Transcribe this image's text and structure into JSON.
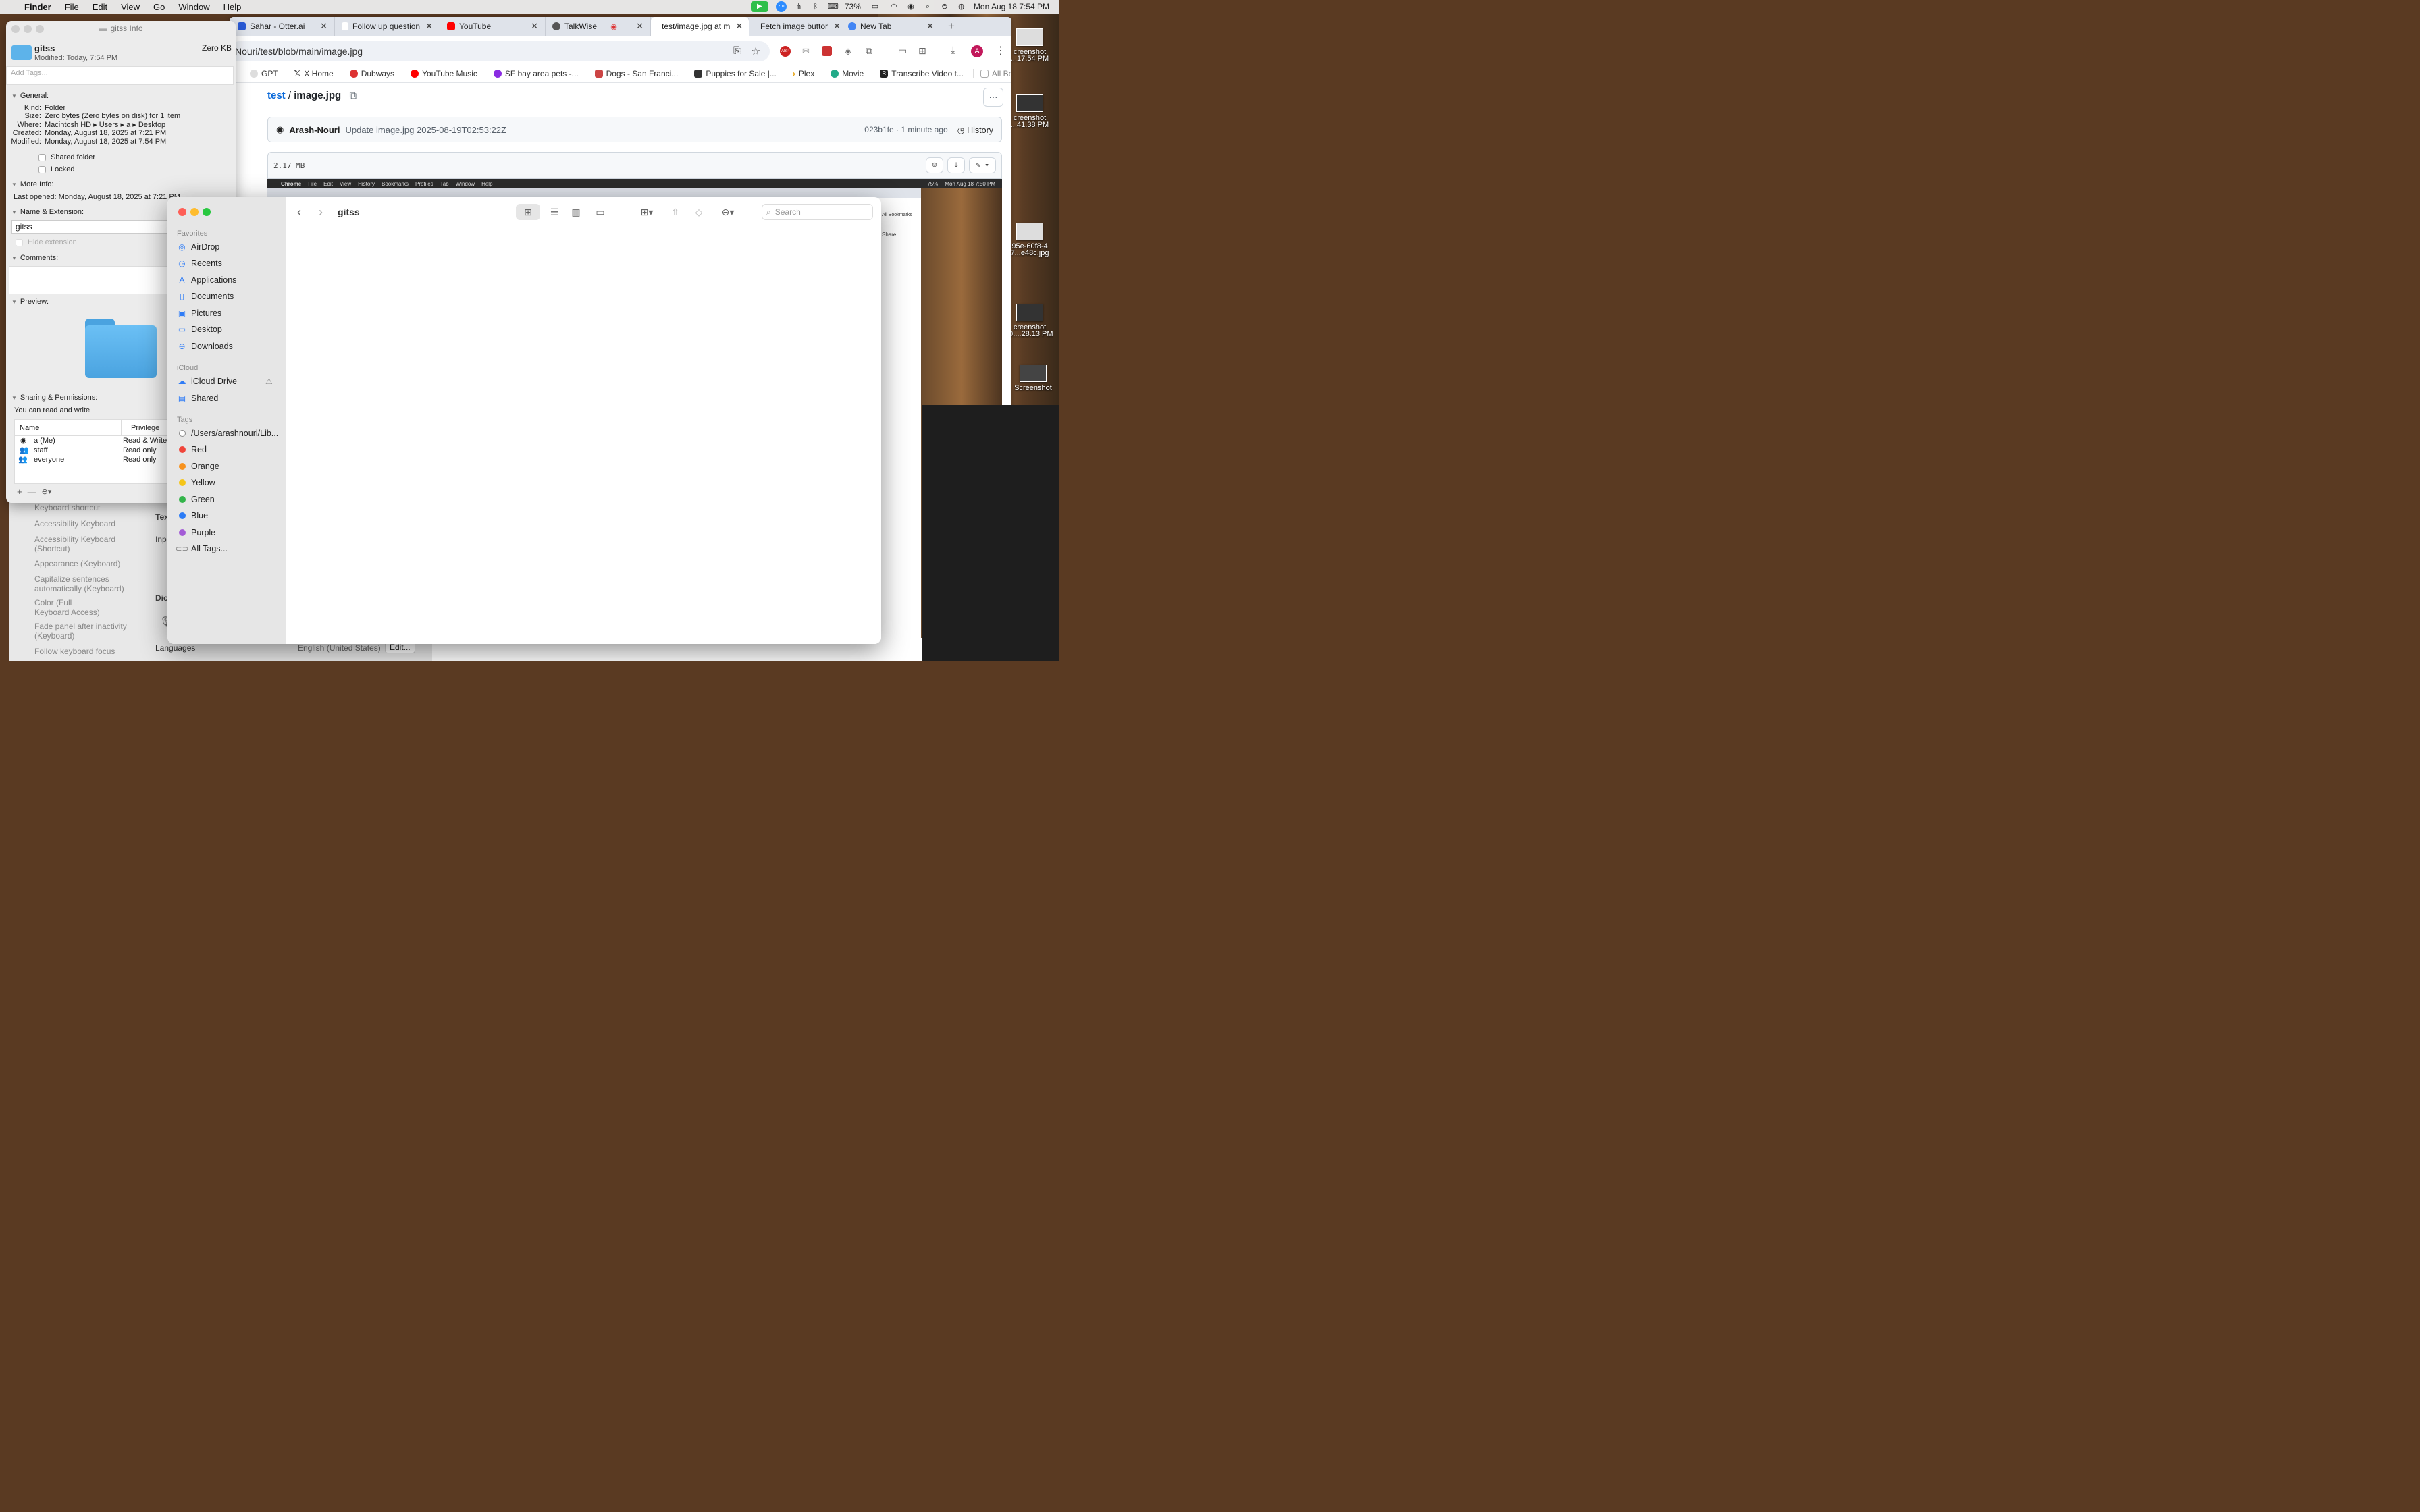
{
  "menubar": {
    "app": "Finder",
    "items": [
      "File",
      "Edit",
      "View",
      "Go",
      "Window",
      "Help"
    ],
    "battery": "73%",
    "datetime": "Mon Aug 18  7:54 PM"
  },
  "chrome": {
    "tabs": [
      {
        "label": "Sahar - Otter.ai"
      },
      {
        "label": "Follow up question"
      },
      {
        "label": "YouTube"
      },
      {
        "label": "TalkWise"
      },
      {
        "label": "test/image.jpg at m"
      },
      {
        "label": "Fetch image buttor"
      },
      {
        "label": "New Tab"
      }
    ],
    "url": "Nouri/test/blob/main/image.jpg",
    "bookmarks": [
      "GPT",
      "X Home",
      "Dubways",
      "YouTube Music",
      "SF bay area pets -...",
      "Dogs - San Franci...",
      "Puppies for Sale |...",
      "Plex",
      "Movie",
      "Transcribe Video t...",
      "All Bookmarks"
    ]
  },
  "github": {
    "repo": "test",
    "sep": "/",
    "file": "image.jpg",
    "author": "Arash-Nouri",
    "commit_msg": "Update image.jpg 2025-08-19T02:53:22Z",
    "commit_meta": "023b1fe · 1 minute ago",
    "history": "History",
    "size": "2.17 MB"
  },
  "embedded": {
    "menubar": [
      "Chrome",
      "File",
      "Edit",
      "View",
      "History",
      "Bookmarks",
      "Profiles",
      "Tab",
      "Window",
      "Help"
    ],
    "datetime": "Mon Aug 18  7:50 PM",
    "battery": "75%",
    "share": "Share",
    "all_bookmarks": "All Bookmarks"
  },
  "info": {
    "title": "gitss Info",
    "name": "gitss",
    "size_head": "Zero KB",
    "modified_head": "Modified: Today, 7:54 PM",
    "tags_placeholder": "Add Tags...",
    "general_head": "General:",
    "kind_k": "Kind:",
    "kind_v": "Folder",
    "size_k": "Size:",
    "size_v": "Zero bytes (Zero bytes on disk) for 1 item",
    "where_k": "Where:",
    "where_v": "Macintosh HD ▸ Users ▸ a ▸ Desktop",
    "created_k": "Created:",
    "created_v": "Monday, August 18, 2025 at 7:21 PM",
    "modified_k": "Modified:",
    "modified_v": "Monday, August 18, 2025 at 7:54 PM",
    "shared_folder": "Shared folder",
    "locked": "Locked",
    "more_info": "More Info:",
    "last_opened": "Last opened: Monday, August 18, 2025 at 7:21 PM",
    "name_ext": "Name & Extension:",
    "name_value": "gitss",
    "hide_ext": "Hide extension",
    "comments": "Comments:",
    "preview": "Preview:",
    "sharing": "Sharing & Permissions:",
    "you_can": "You can read and write",
    "col_name": "Name",
    "col_priv": "Privilege",
    "perms": [
      {
        "name": "a (Me)",
        "priv": "Read & Write"
      },
      {
        "name": "staff",
        "priv": "Read only"
      },
      {
        "name": "everyone",
        "priv": "Read only"
      }
    ]
  },
  "finder": {
    "title": "gitss",
    "search_placeholder": "Search",
    "favorites_head": "Favorites",
    "favorites": [
      "AirDrop",
      "Recents",
      "Applications",
      "Documents",
      "Pictures",
      "Desktop",
      "Downloads"
    ],
    "icloud_head": "iCloud",
    "icloud": [
      "iCloud Drive",
      "Shared"
    ],
    "tags_head": "Tags",
    "tags": [
      {
        "label": "/Users/arashnouri/Lib...",
        "color": "#ffffff"
      },
      {
        "label": "Red",
        "color": "#f0453a"
      },
      {
        "label": "Orange",
        "color": "#f7921e"
      },
      {
        "label": "Yellow",
        "color": "#f5c518"
      },
      {
        "label": "Green",
        "color": "#33b44a"
      },
      {
        "label": "Blue",
        "color": "#2c7cf6"
      },
      {
        "label": "Purple",
        "color": "#a35bd6"
      },
      {
        "label": "All Tags...",
        "color": ""
      }
    ]
  },
  "syspref": {
    "items": [
      "Keyboard shortcut",
      "Accessibility Keyboard",
      "Accessibility Keyboard (Shortcut)",
      "Appearance (Keyboard)",
      "Capitalize sentences automatically (Keyboard)",
      "Color (Full Keyboard Access)",
      "Fade panel after inactivity (Keyboard)",
      "Follow keyboard focus"
    ],
    "languages_label": "Languages",
    "languages_value": "English (United States)",
    "edit_btn": "Edit...",
    "tex": "Tex",
    "inpu": "Inpu",
    "dic": "Dic"
  },
  "desktop": [
    {
      "label": "creenshot\n...17.54 PM"
    },
    {
      "label": "creenshot\n...41.38 PM"
    },
    {
      "label": "95e-60f8-4\n7...e48c.jpg"
    },
    {
      "label": "creenshot\n-0....28.13 PM"
    },
    {
      "label": "Screenshot"
    }
  ]
}
